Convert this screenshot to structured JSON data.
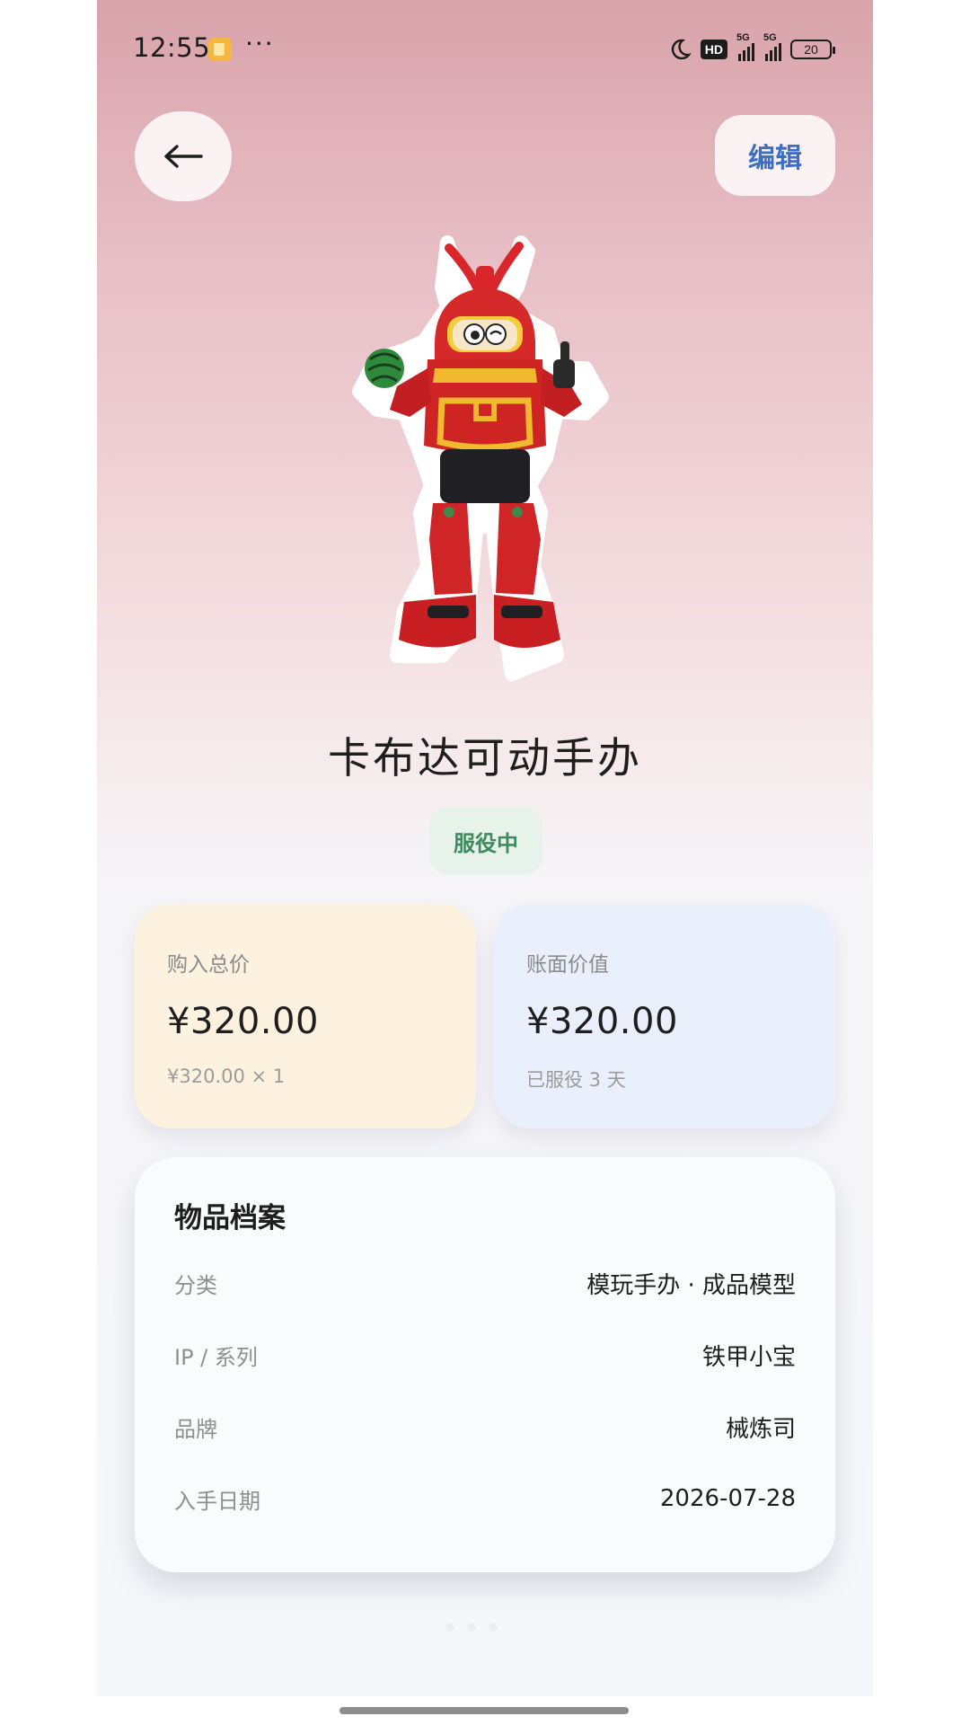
{
  "status_bar": {
    "time": "12:55",
    "dots": "···",
    "hd": "HD",
    "network_1": "5G",
    "network_2": "5G",
    "battery": "20"
  },
  "header": {
    "back_icon": "arrow-left-icon",
    "edit_label": "编辑"
  },
  "product": {
    "image": "red-robot-figure",
    "title": "卡布达可动手办",
    "status": "服役中"
  },
  "cards": {
    "purchase": {
      "label": "购入总价",
      "value": "¥320.00",
      "sub": "¥320.00 × 1"
    },
    "book_value": {
      "label": "账面价值",
      "value": "¥320.00",
      "sub": "已服役 3 天"
    }
  },
  "archive": {
    "title": "物品档案",
    "rows": [
      {
        "key": "分类",
        "value": "模玩手办 · 成品模型"
      },
      {
        "key": "IP / 系列",
        "value": "铁甲小宝"
      },
      {
        "key": "品牌",
        "value": "械炼司"
      },
      {
        "key": "入手日期",
        "value": "2026-07-28"
      }
    ]
  },
  "colors": {
    "accent_blue": "#3c6fc4",
    "status_green": "#3f8a5e",
    "purchase_card": "#fcf2df",
    "book_card": "#eaf0fb"
  }
}
